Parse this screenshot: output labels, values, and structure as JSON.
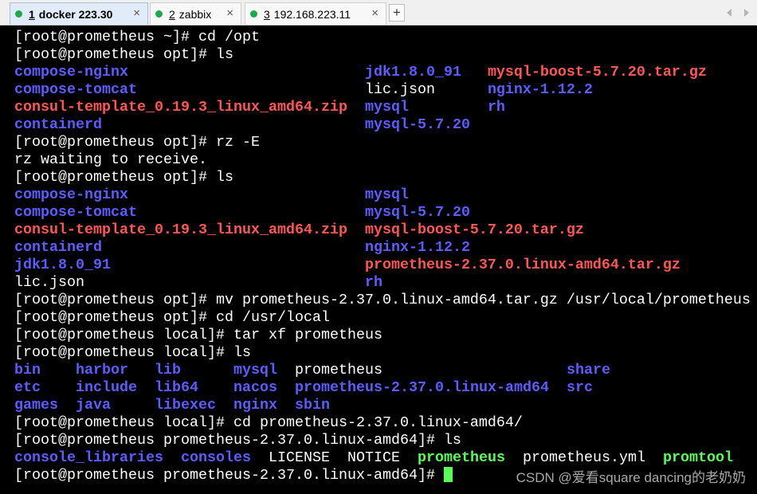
{
  "tabs": [
    {
      "number": "1",
      "label": "docker 223.30",
      "close": "×",
      "active": true
    },
    {
      "number": "2",
      "label": "zabbix",
      "close": "×",
      "active": false
    },
    {
      "number": "3",
      "label": "192.168.223.11",
      "close": "×",
      "active": false
    }
  ],
  "tab_status_icon": "connection-status-icon",
  "tab_status_color": "#1fa94e",
  "new_tab": {
    "label": "+"
  },
  "tab_scroll": {
    "left_icon": "scroll-left-icon",
    "right_icon": "scroll-right-icon"
  },
  "terminal": {
    "colors": {
      "background": "#000000",
      "text": "#ffffff",
      "dir": "#5c5cff",
      "archive": "#ff5555",
      "exec": "#55ff55",
      "cursor": "#55ff55"
    },
    "cursor_visible": true,
    "lines": [
      [
        {
          "text": "[root@prometheus ~]# cd /opt",
          "kind": "text"
        }
      ],
      [
        {
          "text": "[root@prometheus opt]# ls",
          "kind": "text"
        }
      ],
      [
        {
          "text": "compose-nginx                           ",
          "kind": "dir"
        },
        {
          "text": "jdk1.8.0_91   ",
          "kind": "dir"
        },
        {
          "text": "mysql-boost-5.7.20.tar.gz",
          "kind": "archive"
        }
      ],
      [
        {
          "text": "compose-tomcat                          ",
          "kind": "dir"
        },
        {
          "text": "lic.json      ",
          "kind": "file"
        },
        {
          "text": "nginx-1.12.2",
          "kind": "dir"
        }
      ],
      [
        {
          "text": "consul-template_0.19.3_linux_amd64.zip  ",
          "kind": "archive"
        },
        {
          "text": "mysql         ",
          "kind": "dir"
        },
        {
          "text": "rh",
          "kind": "dir"
        }
      ],
      [
        {
          "text": "containerd                              ",
          "kind": "dir"
        },
        {
          "text": "mysql-5.7.20",
          "kind": "dir"
        }
      ],
      [
        {
          "text": "[root@prometheus opt]# rz -E",
          "kind": "text"
        }
      ],
      [
        {
          "text": "rz waiting to receive.",
          "kind": "text"
        }
      ],
      [
        {
          "text": "[root@prometheus opt]# ls",
          "kind": "text"
        }
      ],
      [
        {
          "text": "compose-nginx                           ",
          "kind": "dir"
        },
        {
          "text": "mysql",
          "kind": "dir"
        }
      ],
      [
        {
          "text": "compose-tomcat                          ",
          "kind": "dir"
        },
        {
          "text": "mysql-5.7.20",
          "kind": "dir"
        }
      ],
      [
        {
          "text": "consul-template_0.19.3_linux_amd64.zip  ",
          "kind": "archive"
        },
        {
          "text": "mysql-boost-5.7.20.tar.gz",
          "kind": "archive"
        }
      ],
      [
        {
          "text": "containerd                              ",
          "kind": "dir"
        },
        {
          "text": "nginx-1.12.2",
          "kind": "dir"
        }
      ],
      [
        {
          "text": "jdk1.8.0_91                             ",
          "kind": "dir"
        },
        {
          "text": "prometheus-2.37.0.linux-amd64.tar.gz",
          "kind": "archive"
        }
      ],
      [
        {
          "text": "lic.json                                ",
          "kind": "file"
        },
        {
          "text": "rh",
          "kind": "dir"
        }
      ],
      [
        {
          "text": "[root@prometheus opt]# mv prometheus-2.37.0.linux-amd64.tar.gz /usr/local/prometheus",
          "kind": "text"
        }
      ],
      [
        {
          "text": "[root@prometheus opt]# cd /usr/local",
          "kind": "text"
        }
      ],
      [
        {
          "text": "[root@prometheus local]# tar xf prometheus",
          "kind": "text"
        }
      ],
      [
        {
          "text": "[root@prometheus local]# ls",
          "kind": "text"
        }
      ],
      [
        {
          "text": "bin    ",
          "kind": "dir"
        },
        {
          "text": "harbor   ",
          "kind": "dir"
        },
        {
          "text": "lib      ",
          "kind": "dir"
        },
        {
          "text": "mysql  ",
          "kind": "dir"
        },
        {
          "text": "prometheus                     ",
          "kind": "file"
        },
        {
          "text": "share",
          "kind": "dir"
        }
      ],
      [
        {
          "text": "etc    ",
          "kind": "dir"
        },
        {
          "text": "include  ",
          "kind": "dir"
        },
        {
          "text": "lib64    ",
          "kind": "dir"
        },
        {
          "text": "nacos  ",
          "kind": "dir"
        },
        {
          "text": "prometheus-2.37.0.linux-amd64  ",
          "kind": "dir"
        },
        {
          "text": "src",
          "kind": "dir"
        }
      ],
      [
        {
          "text": "games  ",
          "kind": "dir"
        },
        {
          "text": "java     ",
          "kind": "dir"
        },
        {
          "text": "libexec  ",
          "kind": "dir"
        },
        {
          "text": "nginx  ",
          "kind": "dir"
        },
        {
          "text": "sbin",
          "kind": "dir"
        }
      ],
      [
        {
          "text": "[root@prometheus local]# cd prometheus-2.37.0.linux-amd64/",
          "kind": "text"
        }
      ],
      [
        {
          "text": "[root@prometheus prometheus-2.37.0.linux-amd64]# ls",
          "kind": "text"
        }
      ],
      [
        {
          "text": "console_libraries  ",
          "kind": "dir"
        },
        {
          "text": "consoles  ",
          "kind": "dir"
        },
        {
          "text": "LICENSE  ",
          "kind": "file"
        },
        {
          "text": "NOTICE  ",
          "kind": "file"
        },
        {
          "text": "prometheus  ",
          "kind": "exec"
        },
        {
          "text": "prometheus.yml  ",
          "kind": "file"
        },
        {
          "text": "promtool",
          "kind": "exec"
        }
      ],
      [
        {
          "text": "[root@prometheus prometheus-2.37.0.linux-amd64]# ",
          "kind": "text"
        }
      ]
    ]
  },
  "watermark": "CSDN @爱看square dancing的老奶奶"
}
